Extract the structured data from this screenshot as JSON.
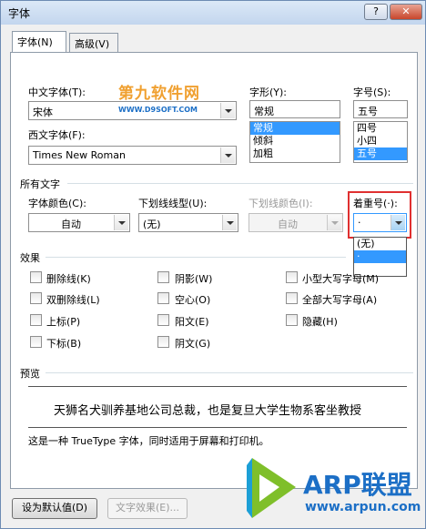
{
  "window": {
    "title": "字体",
    "help_label": "?",
    "close_label": "✕"
  },
  "tabs": [
    {
      "label": "字体(N)"
    },
    {
      "label": "高级(V)"
    }
  ],
  "font": {
    "chinese_label": "中文字体(T):",
    "chinese_value": "宋体",
    "western_label": "西文字体(F):",
    "western_value": "Times New Roman",
    "style_label": "字形(Y):",
    "style_value": "常规",
    "style_options": [
      "常规",
      "倾斜",
      "加粗"
    ],
    "size_label": "字号(S):",
    "size_value": "五号",
    "size_options": [
      "四号",
      "小四",
      "五号"
    ]
  },
  "all_text": {
    "section_label": "所有文字",
    "color_label": "字体颜色(C):",
    "color_value": "自动",
    "underline_label": "下划线线型(U):",
    "underline_value": "(无)",
    "underline_color_label": "下划线颜色(I):",
    "underline_color_value": "自动",
    "emphasis_label": "着重号(·):",
    "emphasis_value": "·",
    "emphasis_options": [
      "(无)",
      "·"
    ]
  },
  "effects": {
    "section_label": "效果",
    "items": [
      "删除线(K)",
      "阴影(W)",
      "小型大写字母(M)",
      "双删除线(L)",
      "空心(O)",
      "全部大写字母(A)",
      "上标(P)",
      "阳文(E)",
      "隐藏(H)",
      "下标(B)",
      "阴文(G)"
    ]
  },
  "preview": {
    "section_label": "预览",
    "sample_text": "天狮名犬驯养基地公司总裁，也是复旦大学生物系客坐教授",
    "note": "这是一种 TrueType 字体，同时适用于屏幕和打印机。"
  },
  "buttons": {
    "set_default": "设为默认值(D)",
    "text_effects": "文字效果(E)..."
  },
  "watermarks": {
    "top_text": "第九软件网",
    "top_url": "WWW.D9SOFT.COM",
    "bottom_text": "ARP联盟",
    "bottom_url": "www.arpun.com"
  },
  "colors": {
    "accent": "#3399ff",
    "highlight_border": "#e03030",
    "watermark_blue": "#1c6fc6",
    "watermark_orange": "#f0a030"
  }
}
